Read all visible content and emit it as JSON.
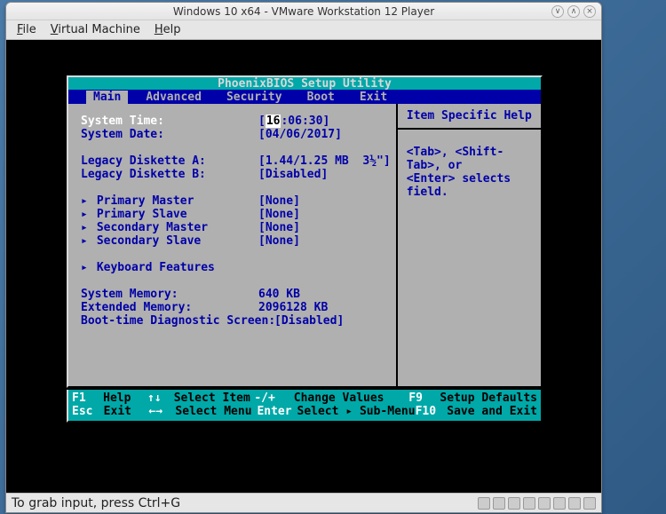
{
  "window": {
    "title": "Windows 10 x64 - VMware Workstation 12 Player"
  },
  "menubar": {
    "file": "File",
    "vm": "Virtual Machine",
    "help": "Help"
  },
  "bios": {
    "title": "PhoenixBIOS Setup Utility",
    "tabs": [
      "Main",
      "Advanced",
      "Security",
      "Boot",
      "Exit"
    ],
    "active_tab": 0,
    "fields": {
      "system_time_label": "System Time:",
      "system_time_value": "[16:06:30]",
      "system_time_hh": "16",
      "system_date_label": "System Date:",
      "system_date_value": "[04/06/2017]",
      "leg_a_label": "Legacy Diskette A:",
      "leg_a_value": "[1.44/1.25 MB  3½\"]",
      "leg_b_label": "Legacy Diskette B:",
      "leg_b_value": "[Disabled]",
      "pm_label": "Primary Master",
      "pm_value": "[None]",
      "ps_label": "Primary Slave",
      "ps_value": "[None]",
      "sm_label": "Secondary Master",
      "sm_value": "[None]",
      "ss_label": "Secondary Slave",
      "ss_value": "[None]",
      "kb_label": "Keyboard Features",
      "sysmem_label": "System Memory:",
      "sysmem_value": "640 KB",
      "extmem_label": "Extended Memory:",
      "extmem_value": "2096128 KB",
      "bootdiag_label": "Boot-time Diagnostic Screen:",
      "bootdiag_value": "[Disabled]"
    },
    "help": {
      "title": "Item Specific Help",
      "body1": "<Tab>, <Shift-Tab>, or",
      "body2": "<Enter> selects field."
    },
    "footer": {
      "r1": {
        "k1": "F1",
        "a1": "Help",
        "k2": "↑↓",
        "a2": "Select Item",
        "k3": "-/+",
        "a3": "Change Values",
        "k4": "F9",
        "a4": "Setup Defaults"
      },
      "r2": {
        "k1": "Esc",
        "a1": "Exit",
        "k2": "←→",
        "a2": "Select Menu",
        "k3": "Enter",
        "a3a": "Select",
        "a3b": "Sub-Menu",
        "k4": "F10",
        "a4": "Save and Exit"
      }
    }
  },
  "statusbar": {
    "text": "To grab input, press Ctrl+G"
  }
}
